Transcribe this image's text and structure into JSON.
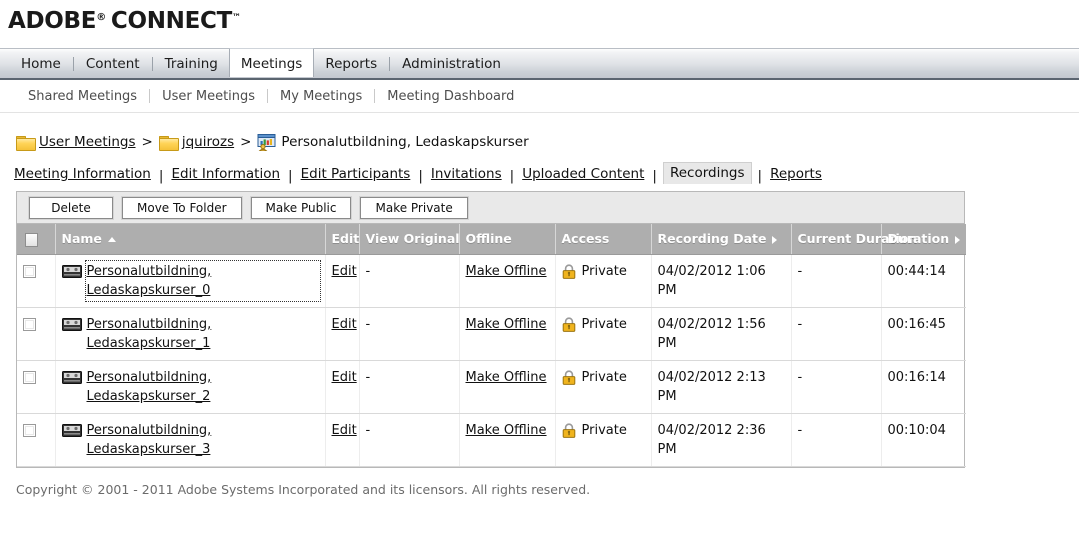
{
  "brand": {
    "name_1": "ADOBE",
    "registered": "®",
    "name_2": "CONNECT",
    "trademark": "™"
  },
  "primary_tabs": [
    {
      "label": "Home",
      "active": false
    },
    {
      "label": "Content",
      "active": false
    },
    {
      "label": "Training",
      "active": false
    },
    {
      "label": "Meetings",
      "active": true
    },
    {
      "label": "Reports",
      "active": false
    },
    {
      "label": "Administration",
      "active": false
    }
  ],
  "sub_nav": [
    {
      "label": "Shared Meetings"
    },
    {
      "label": "User Meetings"
    },
    {
      "label": "My Meetings"
    },
    {
      "label": "Meeting Dashboard"
    }
  ],
  "breadcrumb": {
    "items": [
      {
        "label": "User Meetings",
        "icon": "folder-icon",
        "link": true
      },
      {
        "label": "jquirozs",
        "icon": "folder-icon",
        "link": true
      },
      {
        "label": "Personalutbildning, Ledaskapskurser",
        "icon": "meeting-icon",
        "link": false
      }
    ],
    "separator": ">"
  },
  "object_tabs": {
    "items": [
      {
        "label": "Meeting Information",
        "current": false
      },
      {
        "label": "Edit Information",
        "current": false
      },
      {
        "label": "Edit Participants",
        "current": false
      },
      {
        "label": "Invitations",
        "current": false
      },
      {
        "label": "Uploaded Content",
        "current": false
      },
      {
        "label": "Recordings",
        "current": true
      },
      {
        "label": "Reports",
        "current": false
      }
    ],
    "separator": "|"
  },
  "toolbar": {
    "buttons": [
      {
        "label": "Delete"
      },
      {
        "label": "Move To Folder"
      },
      {
        "label": "Make Public"
      },
      {
        "label": "Make Private"
      }
    ]
  },
  "table": {
    "columns": [
      {
        "label": "",
        "sort": "none",
        "key": "checkbox"
      },
      {
        "label": "Name",
        "sort": "asc",
        "key": "name"
      },
      {
        "label": "Edit",
        "sort": "none",
        "key": "edit"
      },
      {
        "label": "View Original",
        "sort": "none",
        "key": "view_original"
      },
      {
        "label": "Offline",
        "sort": "none",
        "key": "offline"
      },
      {
        "label": "Access",
        "sort": "none",
        "key": "access"
      },
      {
        "label": "Recording Date",
        "sort": "right",
        "key": "recording_date"
      },
      {
        "label": "Current Duration",
        "sort": "none",
        "key": "current_duration"
      },
      {
        "label": "Duration",
        "sort": "right",
        "key": "duration"
      }
    ],
    "rows": [
      {
        "name": "Personalutbildning, Ledaskapskurser_0",
        "icon": "recording-tape-icon",
        "focused": true,
        "edit": "Edit",
        "view_original": "-",
        "offline": "Make Offline",
        "access": "Private",
        "access_icon": "lock-icon",
        "recording_date": "04/02/2012 1:06 PM",
        "current_duration": "-",
        "duration": "00:44:14"
      },
      {
        "name": "Personalutbildning, Ledaskapskurser_1",
        "icon": "recording-tape-icon",
        "focused": false,
        "edit": "Edit",
        "view_original": "-",
        "offline": "Make Offline",
        "access": "Private",
        "access_icon": "lock-icon",
        "recording_date": "04/02/2012 1:56 PM",
        "current_duration": "-",
        "duration": "00:16:45"
      },
      {
        "name": "Personalutbildning, Ledaskapskurser_2",
        "icon": "recording-tape-icon",
        "focused": false,
        "edit": "Edit",
        "view_original": "-",
        "offline": "Make Offline",
        "access": "Private",
        "access_icon": "lock-icon",
        "recording_date": "04/02/2012 2:13 PM",
        "current_duration": "-",
        "duration": "00:16:14"
      },
      {
        "name": "Personalutbildning, Ledaskapskurser_3",
        "icon": "recording-tape-icon",
        "focused": false,
        "edit": "Edit",
        "view_original": "-",
        "offline": "Make Offline",
        "access": "Private",
        "access_icon": "lock-icon",
        "recording_date": "04/02/2012 2:36 PM",
        "current_duration": "-",
        "duration": "00:10:04"
      }
    ]
  },
  "footer": {
    "copyright": "Copyright © 2001 - 2011 Adobe Systems Incorporated and its licensors.  All rights reserved."
  },
  "colors": {
    "header_row": "#aeaeae",
    "folder_icon": "#ffd457",
    "lock_icon": "#f0b41e",
    "active_tab_bg": "#ffffff",
    "tabstrip_border": "#5b6570",
    "link_text": "#111111",
    "footer_text": "#6b6b6b"
  }
}
